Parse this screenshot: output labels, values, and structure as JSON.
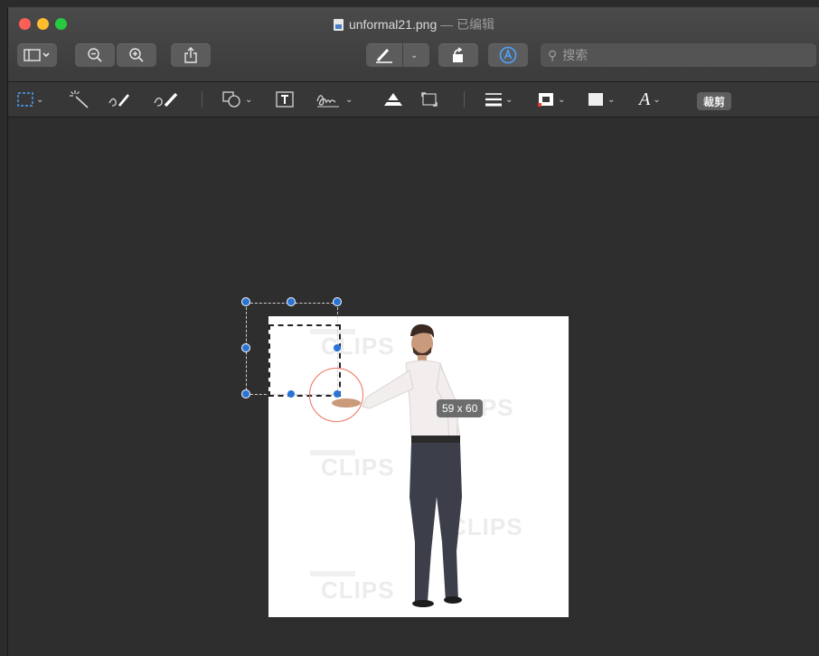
{
  "window": {
    "filename": "unformal21.png",
    "separator": "—",
    "edited_label": "已编辑"
  },
  "toolbar": {
    "sidebar_toggle_icon": "sidebar-icon",
    "zoom_out_icon": "zoom-out-icon",
    "zoom_in_icon": "zoom-in-icon",
    "share_icon": "share-icon",
    "markup_pen_icon": "pen-icon",
    "rotate_icon": "rotate-icon",
    "markup_toggle_icon": "markup-icon",
    "search_placeholder": "搜索"
  },
  "markup_toolbar": {
    "tools": [
      "rect-selection-icon",
      "instant-alpha-icon",
      "sketch-icon",
      "draw-icon",
      "shapes-icon",
      "text-icon",
      "sign-icon",
      "adjust-color-icon",
      "adjust-size-icon",
      "border-style-icon",
      "border-color-icon",
      "fill-color-icon",
      "text-style-icon"
    ],
    "text_style_label": "A",
    "crop_label": "裁剪"
  },
  "canvas": {
    "selection_size": "59 x 60",
    "watermarks": [
      "CLIPS",
      "CLIPS",
      "CLIPS",
      "CLIPS",
      "CLIPS"
    ]
  },
  "colors": {
    "accent": "#2a74d6",
    "magnifier": "#ef6e5e"
  }
}
